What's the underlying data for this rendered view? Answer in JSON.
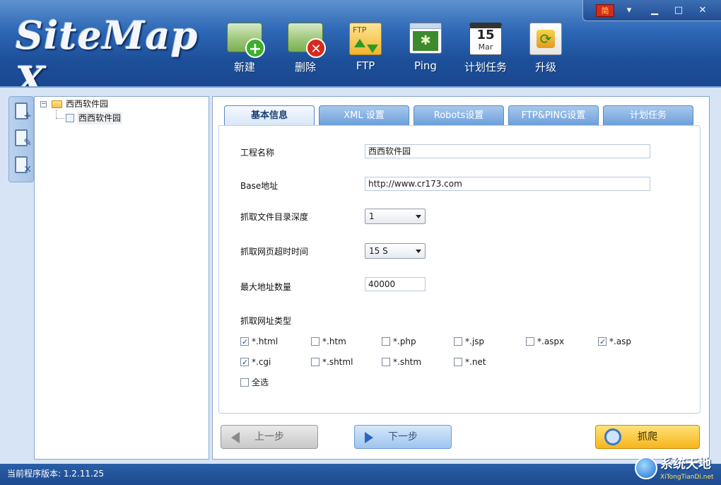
{
  "app": {
    "logo_text": "SiteMap X",
    "version_label": "当前程序版本: 1.2.11.25"
  },
  "window_controls": {
    "language_label": "简",
    "dropdown": "▾",
    "minimize": "▁",
    "maximize": "□",
    "close": "✕"
  },
  "toolbar": [
    {
      "label": "新建",
      "icon": "new-project-icon"
    },
    {
      "label": "删除",
      "icon": "delete-project-icon"
    },
    {
      "label": "FTP",
      "icon": "ftp-icon"
    },
    {
      "label": "Ping",
      "icon": "ping-icon"
    },
    {
      "label": "计划任务",
      "icon": "calendar-icon"
    },
    {
      "label": "升级",
      "icon": "upgrade-icon"
    }
  ],
  "calendar_icon": {
    "day": "15",
    "month": "Mar"
  },
  "ftp_icon_text": "FTP",
  "tree": {
    "root": "西西软件园",
    "expander": "−",
    "child": "西西软件园"
  },
  "tabs": [
    {
      "label": "基本信息",
      "active": true
    },
    {
      "label": "XML 设置",
      "active": false
    },
    {
      "label": "Robots设置",
      "active": false
    },
    {
      "label": "FTP&PING设置",
      "active": false
    },
    {
      "label": "计划任务",
      "active": false
    }
  ],
  "form": {
    "project_name_label": "工程名称",
    "project_name_value": "西西软件园",
    "base_url_label": "Base地址",
    "base_url_value": "http://www.cr173.com",
    "depth_label": "抓取文件目录深度",
    "depth_value": "1",
    "timeout_label": "抓取网页超时时间",
    "timeout_value": "15 S",
    "max_urls_label": "最大地址数量",
    "max_urls_value": "40000",
    "url_types_label": "抓取网址类型"
  },
  "url_types": [
    {
      "label": "*.html",
      "checked": true
    },
    {
      "label": "*.htm",
      "checked": false
    },
    {
      "label": "*.php",
      "checked": false
    },
    {
      "label": "*.jsp",
      "checked": false
    },
    {
      "label": "*.aspx",
      "checked": false
    },
    {
      "label": "*.asp",
      "checked": true
    },
    {
      "label": "*.cgi",
      "checked": true
    },
    {
      "label": "*.shtml",
      "checked": false
    },
    {
      "label": "*.shtm",
      "checked": false
    },
    {
      "label": "*.net",
      "checked": false
    }
  ],
  "select_all_label": "全选",
  "buttons": {
    "prev": "上一步",
    "next": "下一步",
    "crawl": "抓爬"
  },
  "watermark": {
    "title": "系统天地",
    "url": "XiTongTianDi.net"
  }
}
